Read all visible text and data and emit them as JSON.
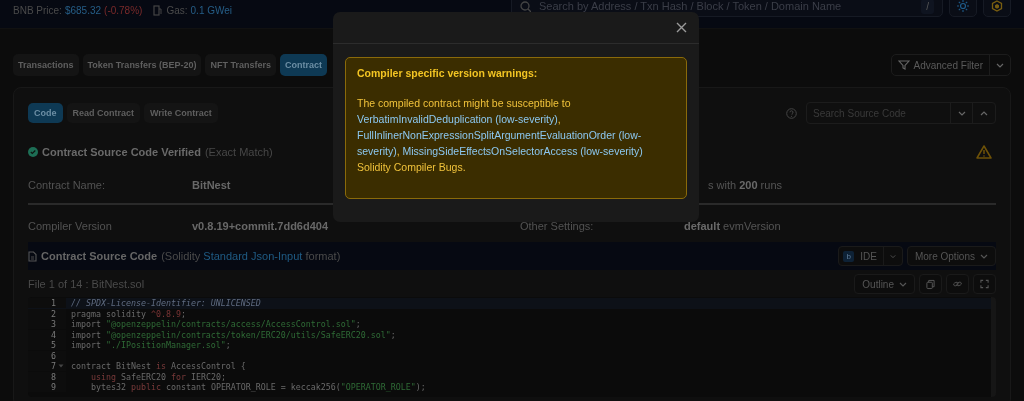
{
  "topbar": {
    "price_label": "BNB Price:",
    "price": "$685.32",
    "change": "(-0.78%)",
    "gas_label": "Gas:",
    "gas": "0.1 GWei",
    "search": {
      "placeholder": "Search by Address / Txn Hash / Block / Token / Domain Name"
    },
    "search_key": "/"
  },
  "tabs": [
    {
      "label": "Transactions",
      "selected": false
    },
    {
      "label": "Token Transfers (BEP-20)",
      "selected": false
    },
    {
      "label": "NFT Transfers",
      "selected": false
    },
    {
      "label": "Contract",
      "selected": true
    }
  ],
  "advanced_filter": "Advanced Filter",
  "subtabs": [
    {
      "label": "Code",
      "selected": true
    },
    {
      "label": "Read Contract",
      "selected": false
    },
    {
      "label": "Write Contract",
      "selected": false
    }
  ],
  "source_search": {
    "placeholder": "Search Source Code"
  },
  "verified": {
    "title": "Contract Source Code Verified",
    "note": "(Exact Match)"
  },
  "info": {
    "name_label": "Contract Name:",
    "name_value": "BitNest",
    "optimization_tail": "s with **200** runs",
    "compiler_label": "Compiler Version",
    "compiler_value": "v0.8.19+commit.7dd6d404",
    "other_label": "Other Settings:",
    "other_value": "**default** evmVersion"
  },
  "source": {
    "title": "Contract Source Code",
    "pre": "(Solidity",
    "link": "Standard Json-Input",
    "post": "format)",
    "ide": "IDE",
    "ide_badge": "b",
    "more": "More Options",
    "file": "File 1 of 14 : BitNest.sol",
    "outline": "Outline"
  },
  "code": [
    {
      "num": "1",
      "fold": false,
      "tokens": [
        {
          "kind": "comment",
          "text": "// SPDX-License-Identifier: UNLICENSED"
        }
      ]
    },
    {
      "num": "2",
      "fold": false,
      "tokens": [
        {
          "kind": "plain",
          "text": "pragma solidity "
        },
        {
          "kind": "number",
          "text": "^0.8.9"
        },
        {
          "kind": "plain",
          "text": ";"
        }
      ]
    },
    {
      "num": "3",
      "fold": false,
      "tokens": [
        {
          "kind": "plain",
          "text": "import "
        },
        {
          "kind": "string",
          "text": "\"@openzeppelin/contracts/access/AccessControl.sol\""
        },
        {
          "kind": "plain",
          "text": ";"
        }
      ]
    },
    {
      "num": "4",
      "fold": false,
      "tokens": [
        {
          "kind": "plain",
          "text": "import "
        },
        {
          "kind": "string",
          "text": "\"@openzeppelin/contracts/token/ERC20/utils/SafeERC20.sol\""
        },
        {
          "kind": "plain",
          "text": ";"
        }
      ]
    },
    {
      "num": "5",
      "fold": false,
      "tokens": [
        {
          "kind": "plain",
          "text": "import "
        },
        {
          "kind": "string",
          "text": "\"./IPositionManager.sol\""
        },
        {
          "kind": "plain",
          "text": ";"
        }
      ]
    },
    {
      "num": "6",
      "fold": false
    },
    {
      "num": "7",
      "fold": true,
      "tokens": [
        {
          "kind": "plain",
          "text": "contract BitNest "
        },
        {
          "kind": "keyword",
          "text": "is"
        },
        {
          "kind": "plain",
          "text": " AccessControl {"
        }
      ]
    },
    {
      "num": "8",
      "fold": false,
      "tokens": [
        {
          "kind": "keyword",
          "text": "    using"
        },
        {
          "kind": "plain",
          "text": " SafeERC20 "
        },
        {
          "kind": "keyword",
          "text": "for"
        },
        {
          "kind": "plain",
          "text": " IERC20;"
        }
      ]
    },
    {
      "num": "9",
      "fold": false,
      "tokens": [
        {
          "kind": "plain",
          "text": "    bytes32 "
        },
        {
          "kind": "keyword",
          "text": "public"
        },
        {
          "kind": "plain",
          "text": " constant OPERATOR_ROLE = keccak256("
        },
        {
          "kind": "string",
          "text": "\"OPERATOR_ROLE\""
        },
        {
          "kind": "plain",
          "text": ");"
        }
      ]
    }
  ],
  "modal": {
    "title": "Compiler specific version warnings:",
    "paragraph": [
      {
        "kind": "text",
        "text": "The compiled contract might be susceptible to "
      },
      {
        "kind": "link",
        "text": "VerbatimInvalidDeduplication"
      },
      {
        "kind": "blue",
        "text": " (low-severity)"
      },
      {
        "kind": "text",
        "text": ", "
      },
      {
        "kind": "link",
        "text": "FullInlinerNonExpressionSplitArgumentEvaluationOrder"
      },
      {
        "kind": "blue",
        "text": " (low-severity)"
      },
      {
        "kind": "text",
        "text": ", "
      },
      {
        "kind": "link",
        "text": "MissingSideEffectsOnSelectorAccess"
      },
      {
        "kind": "blue",
        "text": " (low-severity)"
      },
      {
        "kind": "break"
      },
      {
        "kind": "text",
        "text": "Solidity Compiler Bugs."
      }
    ]
  }
}
